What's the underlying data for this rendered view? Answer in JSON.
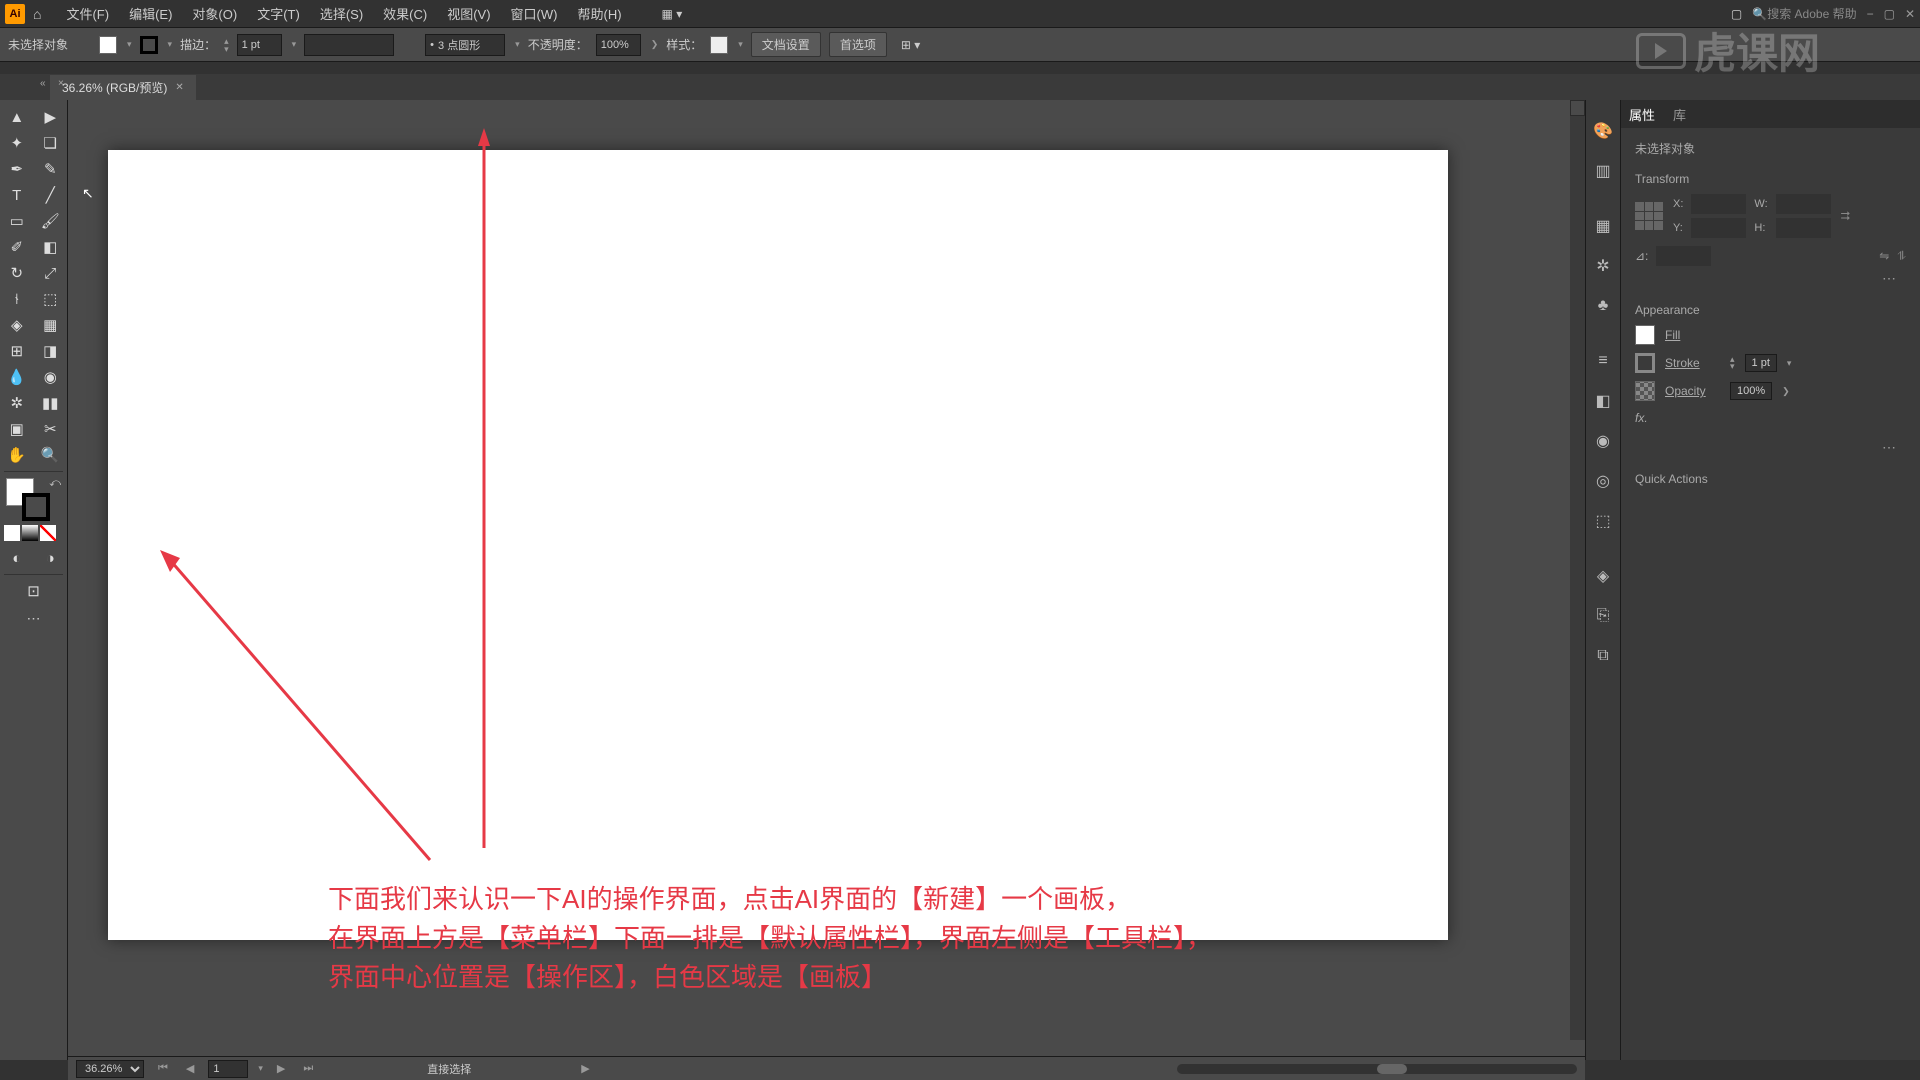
{
  "menubar": {
    "items": [
      "文件(F)",
      "编辑(E)",
      "对象(O)",
      "文字(T)",
      "选择(S)",
      "效果(C)",
      "视图(V)",
      "窗口(W)",
      "帮助(H)"
    ],
    "search_placeholder": "搜索 Adobe 帮助"
  },
  "optionbar": {
    "no_selection": "未选择对象",
    "stroke_label": "描边：",
    "stroke_value": "1 pt",
    "shape_value": "3 点圆形",
    "opacity_label": "不透明度：",
    "opacity_value": "100%",
    "style_label": "样式：",
    "doc_setup": "文档设置",
    "preferences": "首选项"
  },
  "doctab": {
    "title": "36.26% (RGB/预览)"
  },
  "annotation": {
    "line1": "下面我们来认识一下AI的操作界面，点击AI界面的【新建】一个画板，",
    "line2": "在界面上方是【菜单栏】下面一排是【默认属性栏】，界面左侧是【工具栏】，",
    "line3": "界面中心位置是【操作区】，白色区域是【画板】"
  },
  "properties": {
    "tab_props": "属性",
    "tab_libs": "库",
    "no_selection": "未选择对象",
    "transform_title": "Transform",
    "x_label": "X:",
    "y_label": "Y:",
    "w_label": "W:",
    "h_label": "H:",
    "angle_label": "⊿:",
    "appearance_title": "Appearance",
    "fill_label": "Fill",
    "stroke_label": "Stroke",
    "stroke_value": "1 pt",
    "opacity_label": "Opacity",
    "opacity_value": "100%",
    "fx_label": "fx.",
    "quick_actions": "Quick Actions"
  },
  "statusbar": {
    "zoom": "36.26%",
    "artboard": "1",
    "tool_status": "直接选择"
  },
  "watermark": "虎课网"
}
